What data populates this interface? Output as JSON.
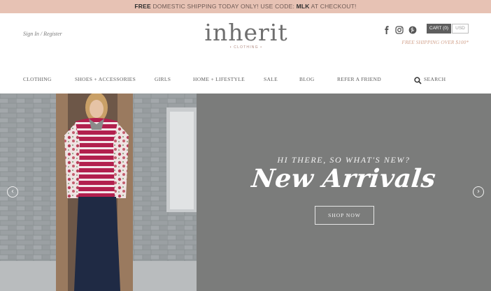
{
  "announcement": {
    "bold_lead": "FREE",
    "text_middle": " DOMESTIC SHIPPING TODAY ONLY! USE CODE: ",
    "code": "MLK",
    "text_end": " AT CHECKOUT!"
  },
  "header": {
    "sign_in": "Sign In / Register",
    "logo_word": "inherit",
    "logo_sub": "• CLOTHING •",
    "social_icons": [
      "facebook-icon",
      "instagram-icon",
      "pinterest-icon"
    ],
    "cart_label": "CART (0)",
    "currency_label": "USD",
    "free_shipping": "FREE SHIPPING OVER $100*"
  },
  "nav": {
    "items": [
      {
        "label": "CLOTHING"
      },
      {
        "label": "SHOES + ACCESSORIES"
      },
      {
        "label": "GIRLS"
      },
      {
        "label": "HOME + LIFESTYLE"
      },
      {
        "label": "SALE"
      },
      {
        "label": "BLOG"
      },
      {
        "label": "REFER A FRIEND"
      }
    ],
    "search_label": "SEARCH"
  },
  "hero": {
    "tagline": "HI THERE, SO WHAT'S NEW?",
    "headline": "New Arrivals",
    "cta_label": "SHOP NOW",
    "prev_arrow": "‹",
    "next_arrow": "›"
  },
  "colors": {
    "announcement_bg": "#e7c2b4",
    "cart_bg": "#5e5e5e",
    "hero_panel_bg": "#7b7c7b",
    "accent_text": "#d3a590"
  }
}
